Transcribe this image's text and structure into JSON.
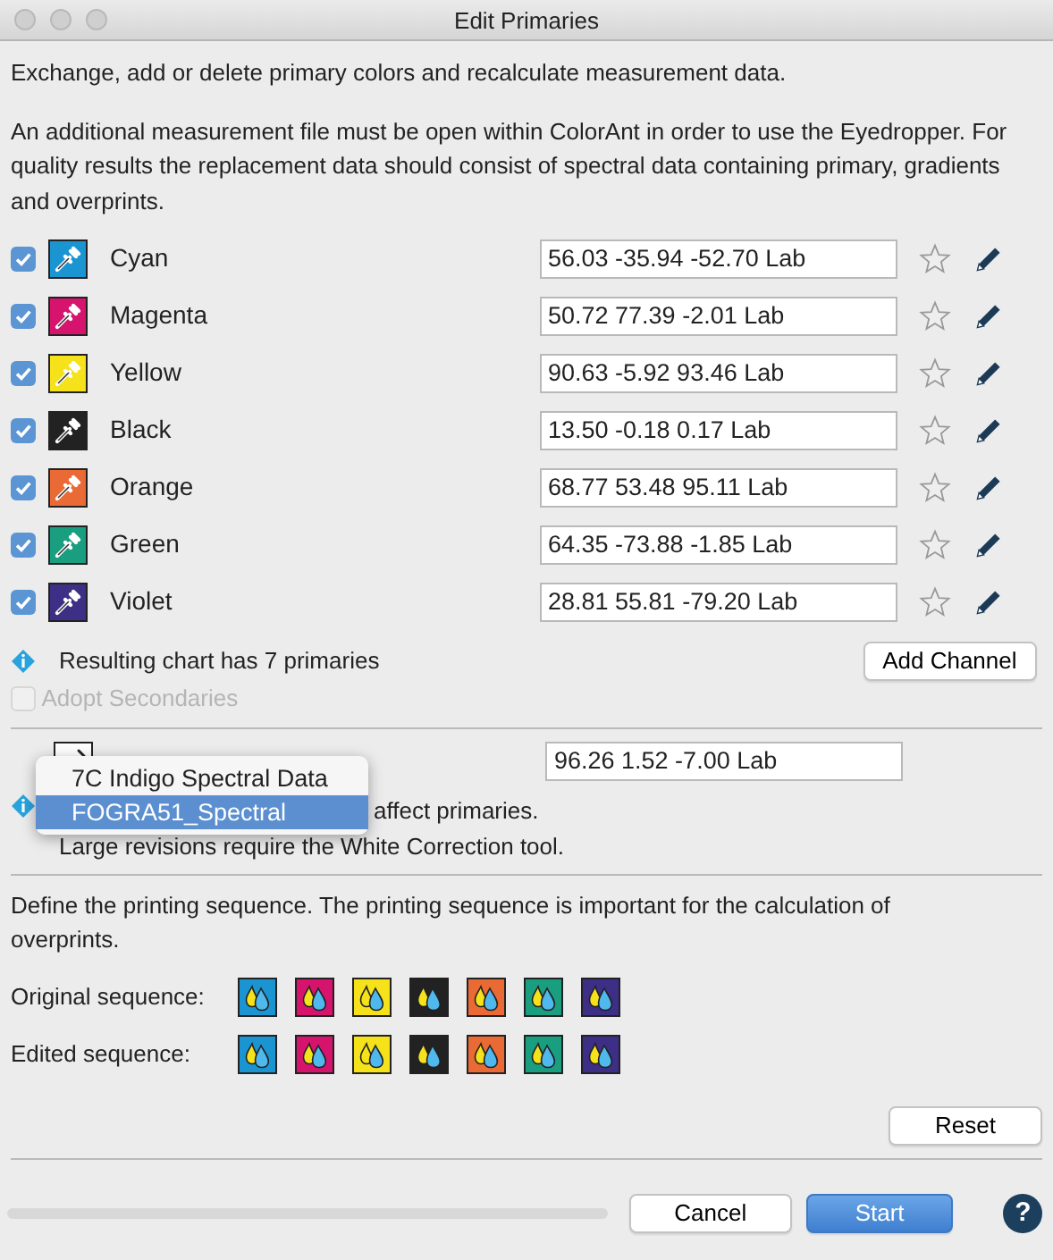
{
  "window": {
    "title": "Edit Primaries"
  },
  "intro": "Exchange, add or delete primary colors and recalculate measurement data.",
  "note": "An additional measurement file must be open within ColorAnt in order to use the Eyedropper. For quality results the replacement data should consist of spectral data containing primary, gradients and overprints.",
  "primaries": [
    {
      "name": "Cyan",
      "checked": true,
      "color": "#1b95d2",
      "lab": "56.03 -35.94 -52.70 Lab"
    },
    {
      "name": "Magenta",
      "checked": true,
      "color": "#d6146e",
      "lab": "50.72 77.39 -2.01 Lab"
    },
    {
      "name": "Yellow",
      "checked": true,
      "color": "#f5e21a",
      "lab": "90.63 -5.92 93.46 Lab"
    },
    {
      "name": "Black",
      "checked": true,
      "color": "#222222",
      "lab": "13.50 -0.18 0.17 Lab"
    },
    {
      "name": "Orange",
      "checked": true,
      "color": "#ea6a35",
      "lab": "68.77 53.48 95.11 Lab"
    },
    {
      "name": "Green",
      "checked": true,
      "color": "#1a9e80",
      "lab": "64.35 -73.88 -1.85 Lab"
    },
    {
      "name": "Violet",
      "checked": true,
      "color": "#3d2e86",
      "lab": "28.81 55.81 -79.20 Lab"
    }
  ],
  "summary": {
    "text": "Resulting chart has 7 primaries",
    "button": "Add Channel"
  },
  "adopt_secondaries": {
    "label": "Adopt Secondaries",
    "checked": false,
    "disabled": true
  },
  "substrate": {
    "lab": "96.26 1.52 -7.00 Lab",
    "info": [
      "affect primaries.",
      "Large revisions require the White Correction tool."
    ]
  },
  "popup_menu": [
    {
      "label": "7C Indigo Spectral Data",
      "selected": false
    },
    {
      "label": "FOGRA51_Spectral",
      "selected": true
    }
  ],
  "sequence": {
    "text": "Define the printing sequence. The printing sequence is important for the calculation of overprints.",
    "rows": [
      {
        "label": "Original sequence:",
        "inks": [
          {
            "color": "#1b95d2"
          },
          {
            "color": "#d6146e"
          },
          {
            "color": "#f5e21a"
          },
          {
            "color": "#222222"
          },
          {
            "color": "#ea6a35"
          },
          {
            "color": "#1a9e80"
          },
          {
            "color": "#3d2e86"
          }
        ]
      },
      {
        "label": "Edited sequence:",
        "inks": [
          {
            "color": "#1b95d2"
          },
          {
            "color": "#d6146e"
          },
          {
            "color": "#f5e21a"
          },
          {
            "color": "#222222"
          },
          {
            "color": "#ea6a35"
          },
          {
            "color": "#1a9e80"
          },
          {
            "color": "#3d2e86"
          }
        ]
      }
    ],
    "reset": "Reset"
  },
  "footer": {
    "buttons": [
      {
        "label": "Cancel",
        "kind": "default"
      },
      {
        "label": "Start",
        "kind": "primary"
      }
    ],
    "help": "?"
  }
}
